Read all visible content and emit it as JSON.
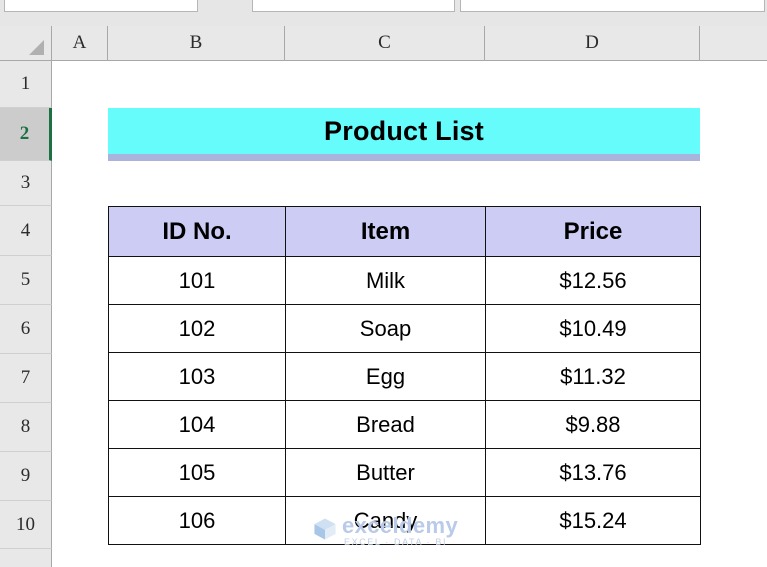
{
  "app": {
    "type": "spreadsheet"
  },
  "ribbon": {
    "boxes": [
      {
        "name": "ribbon-control-1",
        "value": ""
      },
      {
        "name": "ribbon-control-2",
        "value": ""
      },
      {
        "name": "ribbon-control-3",
        "value": ""
      }
    ]
  },
  "grid": {
    "column_headers": [
      "A",
      "B",
      "C",
      "D",
      ""
    ],
    "row_headers": [
      "1",
      "2",
      "3",
      "4",
      "5",
      "6",
      "7",
      "8",
      "9",
      "10"
    ],
    "selected_row": "2",
    "corner_icon": "select-all-triangle-icon"
  },
  "title_cell": {
    "text": "Product List",
    "range": "B2:D2",
    "fill_color": "#66FCFC",
    "accent_color": "#AAB3DA"
  },
  "table": {
    "range": "B4:D10",
    "header_fill": "#CCCCF5",
    "headers": [
      "ID No.",
      "Item",
      "Price"
    ],
    "rows": [
      {
        "id": "101",
        "item": "Milk",
        "price": "$12.56"
      },
      {
        "id": "102",
        "item": "Soap",
        "price": "$10.49"
      },
      {
        "id": "103",
        "item": "Egg",
        "price": "$11.32"
      },
      {
        "id": "104",
        "item": "Bread",
        "price": "$9.88"
      },
      {
        "id": "105",
        "item": "Butter",
        "price": "$13.76"
      },
      {
        "id": "106",
        "item": "Candy",
        "price": "$15.24"
      }
    ]
  },
  "watermark": {
    "name": "exceldemy",
    "tagline": "EXCEL · DATA · BI",
    "color": "#B9CBE8"
  }
}
